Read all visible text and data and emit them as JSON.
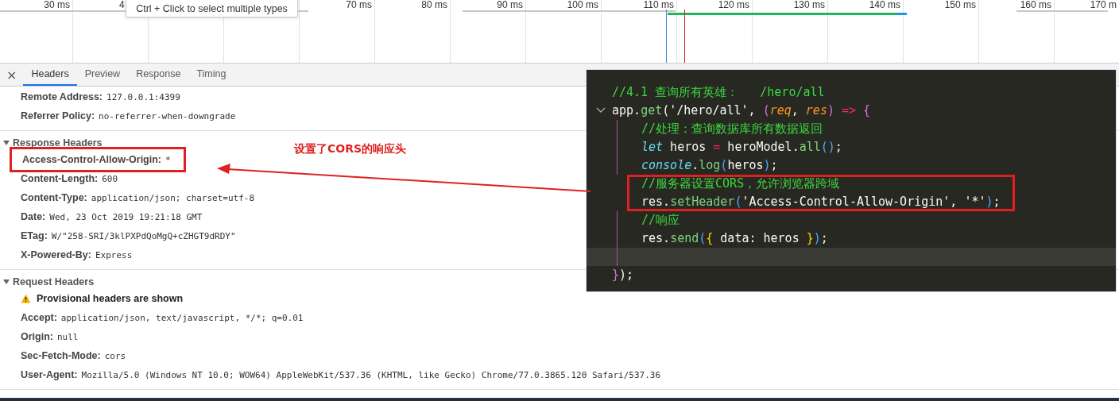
{
  "timeline": {
    "ticks": [
      {
        "label": "30 ms"
      },
      {
        "label": "4",
        "partial": true
      },
      {
        "label": "70 ms",
        "after_tooltip": true
      },
      {
        "label": "80 ms"
      },
      {
        "label": "90 ms"
      },
      {
        "label": "100 ms"
      },
      {
        "label": "110 ms"
      },
      {
        "label": "120 ms"
      },
      {
        "label": "130 ms"
      },
      {
        "label": "140 ms"
      },
      {
        "label": "150 ms"
      },
      {
        "label": "160 ms"
      },
      {
        "label": "170 m"
      }
    ],
    "tooltip": "Ctrl + Click to select multiple types"
  },
  "tabs": {
    "close": "×",
    "items": [
      {
        "label": "Headers",
        "selected": true
      },
      {
        "label": "Preview",
        "selected": false
      },
      {
        "label": "Response",
        "selected": false
      },
      {
        "label": "Timing",
        "selected": false
      }
    ]
  },
  "sections": [
    {
      "rows": [
        {
          "name": "Remote Address:",
          "value": "127.0.0.1:4399",
          "boxed": false
        },
        {
          "name": "Referrer Policy:",
          "value": "no-referrer-when-downgrade",
          "boxed": false
        }
      ]
    },
    {
      "title": "Response Headers",
      "expanded": true,
      "rows": [
        {
          "name": "Access-Control-Allow-Origin:",
          "value": "*",
          "boxed": true
        },
        {
          "name": "Content-Length:",
          "value": "600",
          "boxed": false
        },
        {
          "name": "Content-Type:",
          "value": "application/json; charset=utf-8",
          "boxed": false
        },
        {
          "name": "Date:",
          "value": "Wed, 23 Oct 2019 19:21:18 GMT",
          "boxed": false
        },
        {
          "name": "ETag:",
          "value": "W/\"258-SRI/3klPXPdQoMgQ+cZHGT9dRDY\"",
          "boxed": false
        },
        {
          "name": "X-Powered-By:",
          "value": "Express",
          "boxed": false
        }
      ]
    },
    {
      "title": "Request Headers",
      "expanded": true,
      "warning": "Provisional headers are shown",
      "rows": [
        {
          "name": "Accept:",
          "value": "application/json, text/javascript, */*; q=0.01",
          "boxed": false
        },
        {
          "name": "Origin:",
          "value": "null",
          "boxed": false
        },
        {
          "name": "Sec-Fetch-Mode:",
          "value": "cors",
          "boxed": false
        },
        {
          "name": "User-Agent:",
          "value": "Mozilla/5.0 (Windows NT 10.0; WOW64) AppleWebKit/537.36 (KHTML, like Gecko) Chrome/77.0.3865.120 Safari/537.36",
          "boxed": false
        }
      ]
    }
  ],
  "annotation": {
    "text": "设置了CORS的响应头"
  },
  "code": {
    "lines": [
      {
        "nested": false,
        "fold": false,
        "boxed": false,
        "current": false,
        "tokens": [
          {
            "kind": "comment",
            "text": "//4.1 查询所有英雄：   /hero/all"
          }
        ]
      },
      {
        "nested": false,
        "fold": true,
        "boxed": false,
        "current": false,
        "tokens": [
          {
            "kind": "plain",
            "text": "app."
          },
          {
            "kind": "fn",
            "text": "get"
          },
          {
            "kind": "plain",
            "text": "('/hero/all', "
          },
          {
            "kind": "purple",
            "text": "("
          },
          {
            "kind": "param",
            "text": "req"
          },
          {
            "kind": "plain",
            "text": ", "
          },
          {
            "kind": "param",
            "text": "res"
          },
          {
            "kind": "purple",
            "text": ")"
          },
          {
            "kind": "op",
            "text": " => "
          },
          {
            "kind": "purple",
            "text": "{"
          }
        ]
      },
      {
        "nested": true,
        "fold": false,
        "boxed": false,
        "current": false,
        "tokens": [
          {
            "kind": "comment",
            "text": "//处理：查询数据库所有数据返回"
          }
        ]
      },
      {
        "nested": true,
        "fold": false,
        "boxed": false,
        "current": false,
        "tokens": [
          {
            "kind": "keyword",
            "text": "let"
          },
          {
            "kind": "plain",
            "text": " heros "
          },
          {
            "kind": "op",
            "text": "="
          },
          {
            "kind": "plain",
            "text": " heroModel."
          },
          {
            "kind": "fn",
            "text": "all"
          },
          {
            "kind": "blue",
            "text": "()"
          },
          {
            "kind": "plain",
            "text": ";"
          }
        ]
      },
      {
        "nested": true,
        "fold": false,
        "boxed": false,
        "current": false,
        "tokens": [
          {
            "kind": "keyword",
            "text": "console"
          },
          {
            "kind": "plain",
            "text": "."
          },
          {
            "kind": "fn",
            "text": "log"
          },
          {
            "kind": "blue",
            "text": "("
          },
          {
            "kind": "plain",
            "text": "heros"
          },
          {
            "kind": "blue",
            "text": ")"
          },
          {
            "kind": "plain",
            "text": ";"
          }
        ]
      },
      {
        "nested": true,
        "fold": false,
        "boxed": true,
        "current": false,
        "tokens": [
          {
            "kind": "comment",
            "text": "//服务器设置CORS，允许浏览器跨域"
          }
        ]
      },
      {
        "nested": true,
        "fold": false,
        "boxed": true,
        "current": false,
        "tokens": [
          {
            "kind": "plain",
            "text": "res."
          },
          {
            "kind": "fn",
            "text": "setHeader"
          },
          {
            "kind": "blue",
            "text": "("
          },
          {
            "kind": "plain",
            "text": "'Access-Control-Allow-Origin', '*'"
          },
          {
            "kind": "blue",
            "text": ")"
          },
          {
            "kind": "plain",
            "text": ";"
          }
        ]
      },
      {
        "nested": true,
        "fold": false,
        "boxed": false,
        "current": false,
        "tokens": [
          {
            "kind": "comment",
            "text": "//响应"
          }
        ]
      },
      {
        "nested": true,
        "fold": false,
        "boxed": false,
        "current": false,
        "tokens": [
          {
            "kind": "plain",
            "text": "res."
          },
          {
            "kind": "fn",
            "text": "send"
          },
          {
            "kind": "blue",
            "text": "("
          },
          {
            "kind": "yellow",
            "text": "{"
          },
          {
            "kind": "plain",
            "text": " data: heros "
          },
          {
            "kind": "yellow",
            "text": "}"
          },
          {
            "kind": "blue",
            "text": ")"
          },
          {
            "kind": "plain",
            "text": ";"
          }
        ]
      },
      {
        "nested": true,
        "fold": false,
        "boxed": false,
        "current": true
      },
      {
        "nested": false,
        "fold": false,
        "boxed": false,
        "current": false,
        "tokens": [
          {
            "kind": "purple",
            "text": "}"
          },
          {
            "kind": "plain",
            "text": ");"
          }
        ]
      }
    ]
  }
}
